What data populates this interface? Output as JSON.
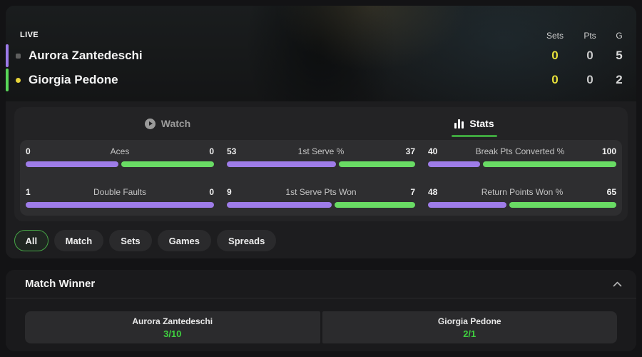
{
  "colors": {
    "purple": "#9e7ce8",
    "green_bar": "#69db64",
    "accent_p1": "#9d7bea",
    "accent_p2": "#59d659",
    "serve_dot_p1": "#5f5f5f",
    "serve_dot_p2": "#e8d43a",
    "sets_value": "#e7e03a",
    "tab_underline": "#3fa53f",
    "odds_green": "#3fcf3f"
  },
  "scoreboard": {
    "live_label": "LIVE",
    "columns": {
      "sets": "Sets",
      "pts": "Pts",
      "games": "G"
    },
    "players": [
      {
        "name": "Aurora Zantedeschi",
        "sets": "0",
        "pts": "0",
        "games": "5"
      },
      {
        "name": "Giorgia Pedone",
        "sets": "0",
        "pts": "0",
        "games": "2"
      }
    ]
  },
  "tabs": {
    "watch_label": "Watch",
    "stats_label": "Stats",
    "active": "Stats"
  },
  "stats": {
    "items": [
      {
        "label": "Aces",
        "left": "0",
        "right": "0"
      },
      {
        "label": "Double Faults",
        "left": "1",
        "right": "0"
      },
      {
        "label": "1st Serve %",
        "left": "53",
        "right": "37"
      },
      {
        "label": "1st Serve Pts Won",
        "left": "9",
        "right": "7"
      },
      {
        "label": "Break Pts Converted %",
        "left": "40",
        "right": "100"
      },
      {
        "label": "Return Points Won %",
        "left": "48",
        "right": "65"
      }
    ]
  },
  "filters": {
    "selected": "All",
    "chips": [
      "All",
      "Match",
      "Sets",
      "Games",
      "Spreads"
    ]
  },
  "market": {
    "title": "Match Winner",
    "selections": [
      {
        "name": "Aurora Zantedeschi",
        "odds": "3/10"
      },
      {
        "name": "Giorgia Pedone",
        "odds": "2/1"
      }
    ]
  }
}
